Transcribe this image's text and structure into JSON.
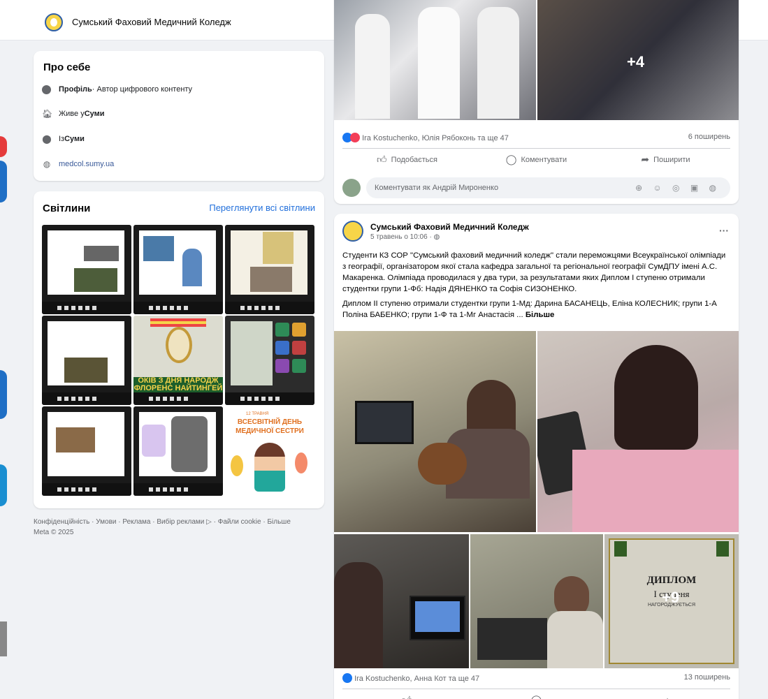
{
  "header": {
    "page_name": "Сумський Фаховий Медичний Коледж",
    "more_label": "···"
  },
  "about": {
    "title": "Про себе",
    "profile_bold": "Профіль",
    "profile_rest": " · Автор цифрового контенту",
    "lives_prefix": "Живе у ",
    "lives_city": "Суми",
    "from_prefix": "Із ",
    "from_city": "Суми",
    "website": "medcol.sumy.ua"
  },
  "photos": {
    "title": "Світлини",
    "see_all": "Переглянути всі світлини",
    "tile5_text": "ОКІВ З ДНЯ НАРОДЖ\nФЛОРЕНС НАЙТИНГЕЙ",
    "tile9_small": "12 ТРАВНЯ",
    "tile9_big": "ВСЕСВІТНІЙ ДЕНЬ МЕДИЧНОЇ СЕСТРИ"
  },
  "footer": {
    "links": "Конфіденційність · Умови · Реклама · Вибір реклами ▷ · Файли cookie · Більше",
    "copyright": "Meta © 2025"
  },
  "post1": {
    "more_photos": "+4",
    "reactions_text": "Ira Kostuchenko, Юлія Рябоконь та ще 47",
    "shares": "6 поширень",
    "like": "Подобається",
    "comment": "Коментувати",
    "share": "Поширити",
    "comment_placeholder": "Коментувати як Андрій Мироненко",
    "comment_icons": "⊕ ☺ ◎ ▣ ◍"
  },
  "post2": {
    "author": "Сумський Фаховий Медичний Коледж",
    "date": "5 травень о 10:06 · ◍",
    "more": "···",
    "paragraph1": "Студенти КЗ СОР \"Сумський фаховий медичний коледж\" стали переможцями Всеукраїнської олімпіади з географії, організатором якої стала кафедра загальної та регіональної географії СумДПУ імені А.С. Макаренка. Олімпіада проводилася у два тури, за результатами яких Диплом І ступеню отримали студентки групи 1-Фб: Надія ДЯНЕНКО та Софія СИЗОНЕНКО.",
    "paragraph2": "Диплом ІІ ступеню отримали студентки групи 1-Мд: Дарина БАСАНЕЦЬ, Еліна КОЛЕСНИК; групи 1-А Поліна БАБЕНКО; групи 1-Ф та 1-Мг Анастасія ...",
    "see_more": "Більше",
    "diploma_title": "ДИПЛОМ",
    "diploma_sub": "І ступеня",
    "diploma_awarded": "НАГОРОДЖУЄТЬСЯ",
    "more_photos": "+9",
    "reactions_text": "Ira Kostuchenko, Анна Кот та ще 47",
    "shares": "13 поширень"
  },
  "colors": {
    "link": "#216fdb",
    "like_blue": "#1877f2",
    "love_red": "#f33e58"
  }
}
